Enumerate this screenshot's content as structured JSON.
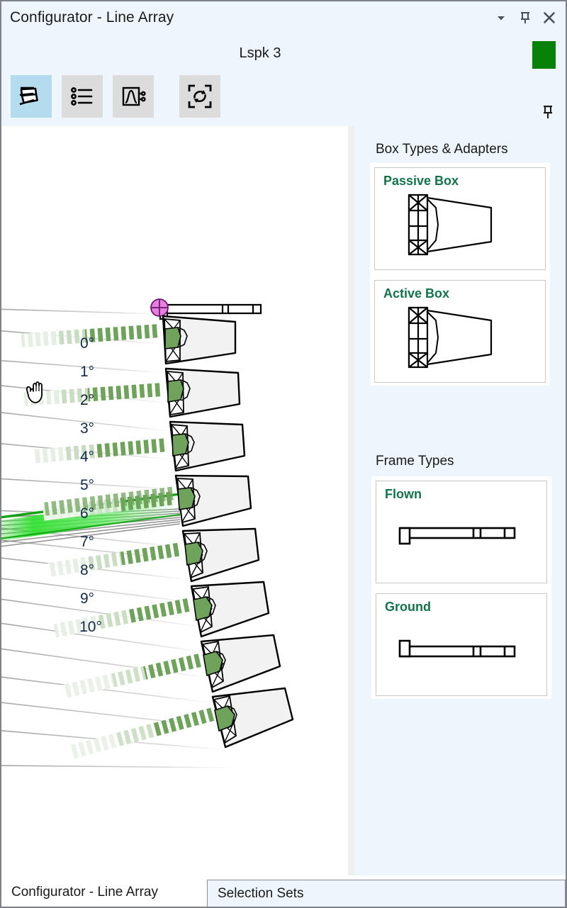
{
  "window": {
    "title": "Configurator - Line Array",
    "controls": [
      {
        "name": "collapse-icon",
        "glyph": "chevron-down"
      },
      {
        "name": "pin-icon",
        "glyph": "pin"
      },
      {
        "name": "close-icon",
        "glyph": "close"
      }
    ]
  },
  "header": {
    "title": "Lspk 3",
    "swatch_color": "#088108",
    "swatch_name": "Lspk 3 color"
  },
  "toolbar": {
    "buttons": [
      {
        "id": "array-view",
        "label": "Array View",
        "icon": "line-array-icon",
        "active": true
      },
      {
        "id": "list-view",
        "label": "List View",
        "icon": "list-icon",
        "active": false
      },
      {
        "id": "response-view",
        "label": "Response View",
        "icon": "response-curve-icon",
        "active": false
      },
      {
        "id": "refresh-view",
        "label": "Refresh / Recalculate",
        "icon": "refresh-frame-icon",
        "active": false
      }
    ],
    "pin": {
      "name": "pin-icon",
      "label": "Pin panel"
    }
  },
  "viewport": {
    "angle_labels": [
      "0°",
      "1°",
      "2°",
      "3°",
      "4°",
      "5°",
      "6°",
      "7°",
      "8°",
      "9°",
      "10°"
    ],
    "selected_angle": "2°",
    "highlight_color": "#33e033",
    "splay_line_color": "#0fa30f",
    "cabinet_count": 8,
    "driver_color": "#6fa35c",
    "cabinet_fill": "#f2f2f2",
    "pickup_point_color": "#e87fe0",
    "cursor": "grab-hand",
    "frame_type_shown": "Flown"
  },
  "sidepanel": {
    "sections": [
      {
        "title": "Box Types & Adapters",
        "cards": [
          {
            "label": "Passive Box",
            "art": "passive-box-icon"
          },
          {
            "label": "Active Box",
            "art": "active-box-icon"
          }
        ]
      },
      {
        "title": "Frame Types",
        "cards": [
          {
            "label": "Flown",
            "art": "flown-frame-icon"
          },
          {
            "label": "Ground",
            "art": "ground-frame-icon"
          }
        ]
      }
    ],
    "accent_color": "#13734a"
  },
  "tabs": [
    {
      "label": "Configurator - Line Array",
      "active": true
    },
    {
      "label": "Selection Sets",
      "active": false
    }
  ]
}
